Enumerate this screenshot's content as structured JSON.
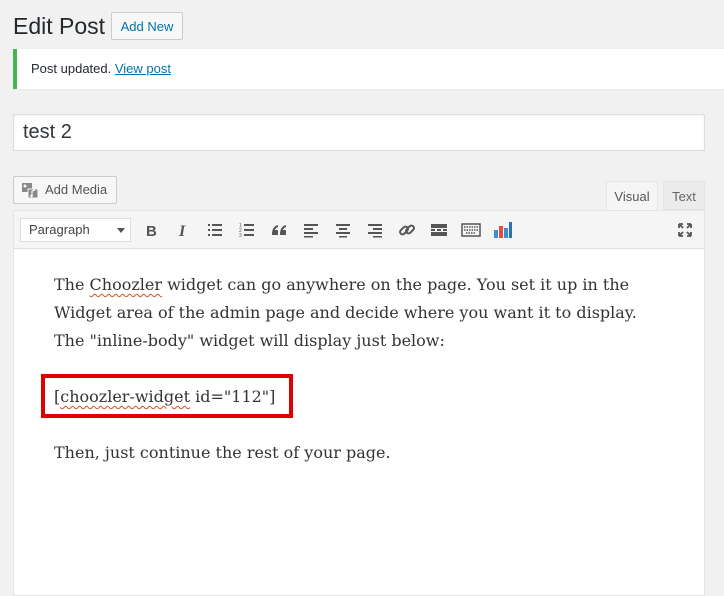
{
  "header": {
    "title": "Edit Post",
    "add_new_label": "Add New"
  },
  "notice": {
    "message": "Post updated.",
    "link_label": "View post",
    "accent_color": "#46b450"
  },
  "post": {
    "title_value": "test 2"
  },
  "media": {
    "add_media_label": "Add Media",
    "icon": "media-icon"
  },
  "editor_tabs": {
    "visual_label": "Visual",
    "text_label": "Text",
    "active": "Visual"
  },
  "toolbar": {
    "format_selected": "Paragraph",
    "buttons": [
      "bold-icon",
      "italic-icon",
      "bullet-list-icon",
      "numbered-list-icon",
      "blockquote-icon",
      "align-left-icon",
      "align-center-icon",
      "align-right-icon",
      "link-icon",
      "read-more-icon",
      "toolbar-toggle-icon",
      "chart-icon",
      "fullscreen-icon"
    ]
  },
  "content": {
    "p1_a": "The ",
    "p1_spell": "Choozler",
    "p1_b": " widget can go anywhere on the page. You set it up in the Widget area of the admin page and decide where you want it to display. The \"inline-body\" widget will display just below:",
    "shortcode_open": "[",
    "shortcode_spell": "choozler-widget",
    "shortcode_rest": " id=\"112\"]",
    "p3": "Then, just continue the rest of your page.",
    "highlight_color": "#e00000"
  }
}
